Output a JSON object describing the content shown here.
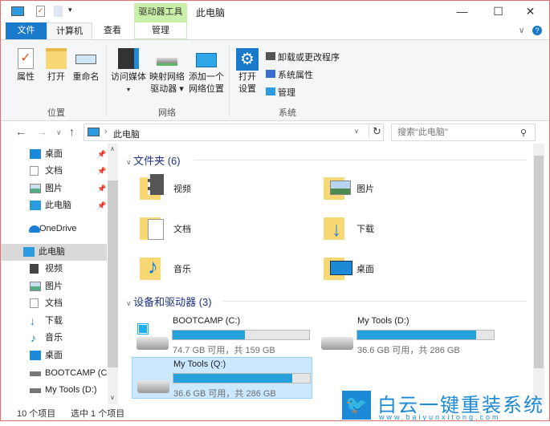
{
  "window": {
    "title": "此电脑",
    "context_group": "驱动器工具",
    "minimize": "—",
    "maximize": "☐",
    "close": "✕"
  },
  "tabs": {
    "file": "文件",
    "computer": "计算机",
    "view": "查看",
    "manage": "管理"
  },
  "ribbon": {
    "location": {
      "label": "位置",
      "properties": "属性",
      "open": "打开",
      "rename": "重命名"
    },
    "network": {
      "label": "网络",
      "media": "访问媒体",
      "map1": "映射网络",
      "map2": "驱动器",
      "addloc1": "添加一个",
      "addloc2": "网络位置"
    },
    "system": {
      "label": "系统",
      "settings1": "打开",
      "settings2": "设置",
      "uninstall": "卸载或更改程序",
      "sysprops": "系统属性",
      "manage": "管理"
    }
  },
  "address": {
    "path": "此电脑",
    "search_placeholder": "搜索\"此电脑\""
  },
  "sidebar": {
    "items": [
      {
        "label": "桌面",
        "pinned": true
      },
      {
        "label": "文档",
        "pinned": true
      },
      {
        "label": "图片",
        "pinned": true
      },
      {
        "label": "此电脑",
        "pinned": true
      },
      {
        "label": "OneDrive"
      },
      {
        "label": "此电脑",
        "selected": true
      },
      {
        "label": "视频"
      },
      {
        "label": "图片"
      },
      {
        "label": "文档"
      },
      {
        "label": "下载"
      },
      {
        "label": "音乐"
      },
      {
        "label": "桌面"
      },
      {
        "label": "BOOTCAMP (C:)"
      },
      {
        "label": "My Tools (D:)"
      }
    ]
  },
  "folders": {
    "header": "文件夹 (6)",
    "items": [
      "视频",
      "图片",
      "文档",
      "下载",
      "音乐",
      "桌面"
    ]
  },
  "drives": {
    "header": "设备和驱动器 (3)",
    "items": [
      {
        "name": "BOOTCAMP (C:)",
        "info": "74.7 GB 可用，共 159 GB",
        "used_pct": 53
      },
      {
        "name": "My Tools (D:)",
        "info": "36.6 GB 可用，共 286 GB",
        "used_pct": 87
      },
      {
        "name": "My Tools (Q:)",
        "info": "36.6 GB 可用，共 286 GB",
        "used_pct": 87,
        "selected": true
      }
    ]
  },
  "status": {
    "count": "10 个项目",
    "selected": "选中 1 个项目"
  },
  "watermark": {
    "brand": "白云一键重装系统",
    "url": "www.baiyunxitong.com"
  },
  "colors": {
    "accent": "#1979ca",
    "context": "#c9f0a8",
    "bar": "#26a0da"
  }
}
